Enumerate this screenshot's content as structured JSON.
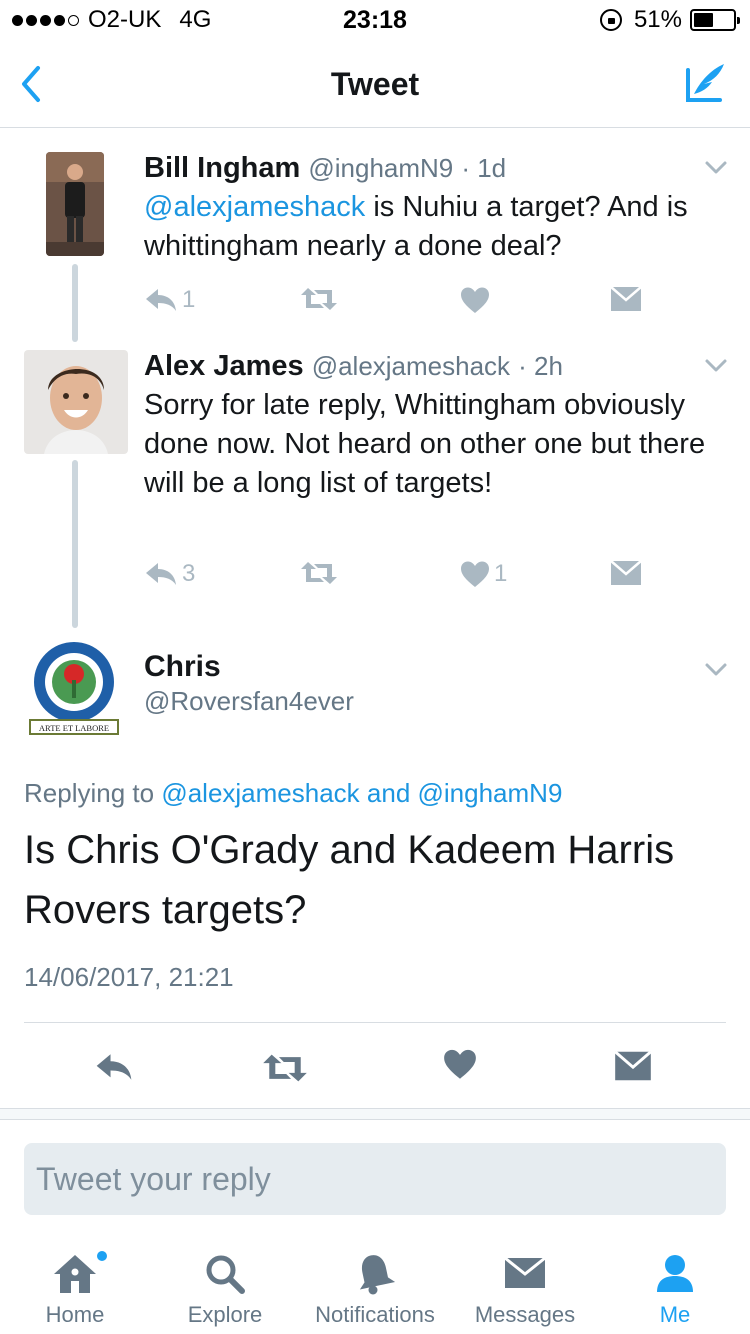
{
  "status_bar": {
    "carrier": "O2-UK",
    "network": "4G",
    "time": "23:18",
    "battery": "51%",
    "battery_level": 0.51
  },
  "nav": {
    "title": "Tweet",
    "back_icon": "chevron-left-icon",
    "compose_icon": "compose-feather-icon"
  },
  "thread": [
    {
      "name": "Bill Ingham",
      "handle": "@inghamN9",
      "time": "· 1d",
      "mention": "@alexjameshack",
      "text": " is Nuhiu a target? And is whittingham nearly a done deal?",
      "reply_count": "1",
      "retweet_count": "",
      "like_count": ""
    },
    {
      "name": "Alex James",
      "handle": "@alexjameshack",
      "time": "· 2h",
      "mention": "",
      "text": "Sorry for late reply, Whittingham obviously done now. Not heard on other one but there will be a long list of targets!",
      "reply_count": "3",
      "retweet_count": "",
      "like_count": "1"
    }
  ],
  "focused": {
    "name": "Chris",
    "handle": "@Roversfan4ever",
    "replying_prefix": "Replying to",
    "replying_to": "@alexjameshack and @inghamN9",
    "text": "Is Chris O'Grady and Kadeem Harris Rovers targets?",
    "date": "14/06/2017, 21:21",
    "avatar_badge_text": "ARTE ET LABORE"
  },
  "reply": {
    "placeholder": "Tweet your reply"
  },
  "tabs": [
    {
      "label": "Home",
      "icon": "home-icon",
      "badge": true
    },
    {
      "label": "Explore",
      "icon": "search-icon"
    },
    {
      "label": "Notifications",
      "icon": "bell-icon"
    },
    {
      "label": "Messages",
      "icon": "envelope-icon"
    },
    {
      "label": "Me",
      "icon": "person-icon",
      "active": true
    }
  ],
  "colors": {
    "accent": "#1da1f2",
    "mention": "#1b95e0",
    "muted": "#657786",
    "action_gray": "#aab8c2",
    "focus_action": "#657786"
  }
}
